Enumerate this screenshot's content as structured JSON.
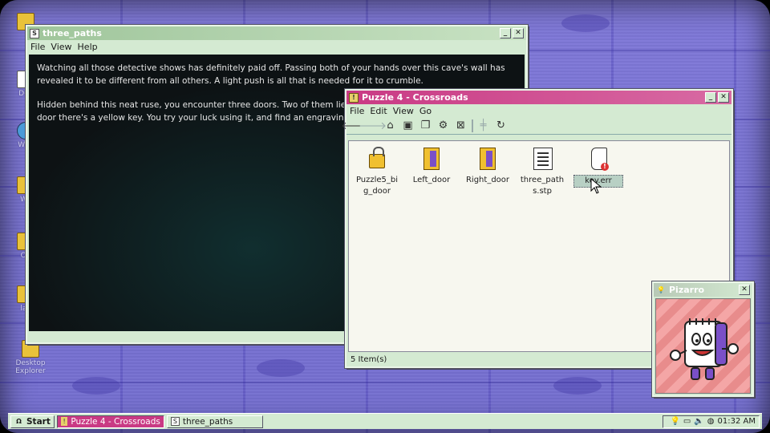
{
  "desktop": {
    "icons": [
      {
        "label": "",
        "icon": "folder-icon"
      },
      {
        "label": "Doc",
        "icon": "document-icon"
      },
      {
        "label": "Web",
        "icon": "globe-icon"
      },
      {
        "label": "Wa",
        "icon": "folder-icon"
      },
      {
        "label": "Op",
        "icon": "folder-icon"
      },
      {
        "label": "lay",
        "icon": "folder-icon"
      },
      {
        "label": "Desktop Explorer",
        "icon": "folder-icon"
      }
    ]
  },
  "text_window": {
    "title": "three_paths",
    "menu": [
      "File",
      "View",
      "Help"
    ],
    "paragraphs": [
      "Watching all those detective shows has definitely paid off. Passing both of your hands over this cave's wall has revealed it to be different from all others. A light push is all that is needed for it to crumble.",
      "Hidden behind this neat ruse, you encounter three doors. Two of them lie on either side of you. Below the central door there's a yellow key. You try your luck using it, and find an engraving on the key, but it's very hard to read."
    ]
  },
  "explorer_window": {
    "title": "Puzzle 4 - Crossroads",
    "menu": [
      "File",
      "Edit",
      "View",
      "Go"
    ],
    "toolbar": [
      "back-arrow-icon",
      "forward-arrow-icon",
      "up-folder-icon",
      "cut-icon",
      "copy-icon",
      "settings-icon",
      "delete-icon",
      "properties-icon",
      "refresh-icon"
    ],
    "files": [
      {
        "name": "Puzzle5_big_door",
        "icon": "locked-folder-icon"
      },
      {
        "name": "Left_door",
        "icon": "folder-icon"
      },
      {
        "name": "Right_door",
        "icon": "folder-icon"
      },
      {
        "name": "three_paths.stp",
        "icon": "text-file-icon"
      },
      {
        "name": "key.err",
        "icon": "error-file-icon"
      }
    ],
    "status": "5 Item(s)"
  },
  "pizarro_window": {
    "title": "Pizarro"
  },
  "taskbar": {
    "start_label": "Start",
    "tasks": [
      "Puzzle 4 - Crossroads",
      "three_paths"
    ],
    "clock": "01:32 AM"
  },
  "colors": {
    "explorer_title": "#c93a84",
    "window_face": "#d4ead2",
    "desktop": "#7a74d4"
  }
}
